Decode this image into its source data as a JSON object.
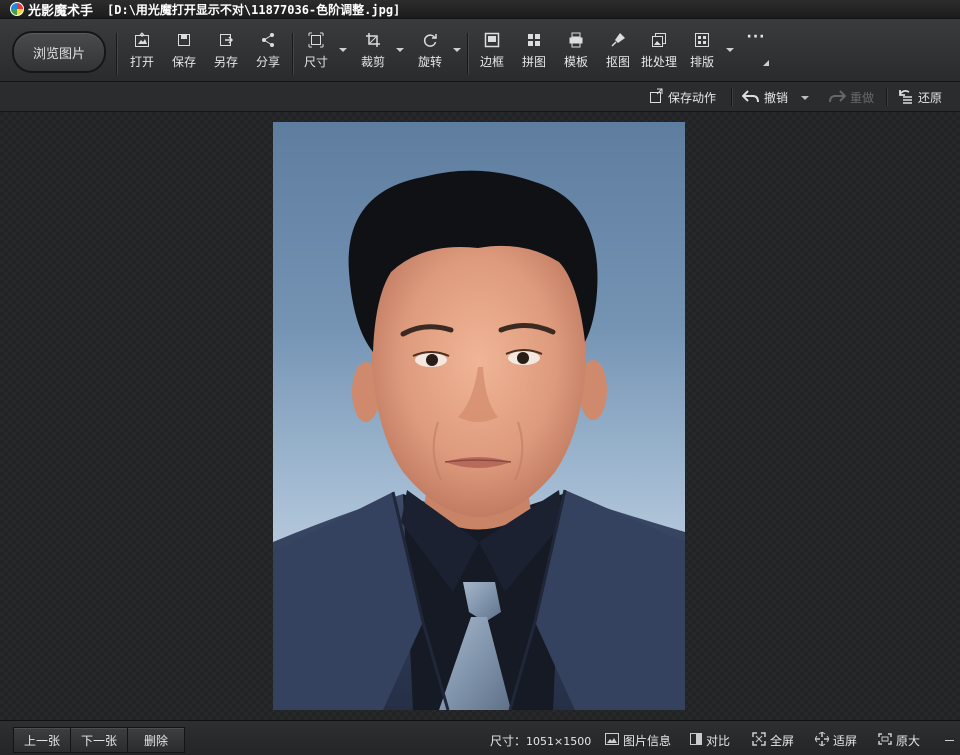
{
  "window": {
    "app_name": "光影魔术手",
    "file_path": "[D:\\用光魔打开显示不对\\11877036-色阶调整.jpg]"
  },
  "toolbar": {
    "browse_label": "浏览图片",
    "items": [
      {
        "label": "打开",
        "icon": "open-icon"
      },
      {
        "label": "保存",
        "icon": "save-icon"
      },
      {
        "label": "另存",
        "icon": "save-as-icon"
      },
      {
        "label": "分享",
        "icon": "share-icon"
      },
      {
        "label": "尺寸",
        "icon": "resize-icon"
      },
      {
        "label": "裁剪",
        "icon": "crop-icon"
      },
      {
        "label": "旋转",
        "icon": "rotate-icon"
      },
      {
        "label": "边框",
        "icon": "border-icon"
      },
      {
        "label": "拼图",
        "icon": "collage-icon"
      },
      {
        "label": "模板",
        "icon": "template-icon"
      },
      {
        "label": "抠图",
        "icon": "cutout-icon"
      },
      {
        "label": "批处理",
        "icon": "batch-icon"
      },
      {
        "label": "排版",
        "icon": "layout-icon"
      }
    ],
    "more_label": "···"
  },
  "actionbar": {
    "save_action": "保存动作",
    "undo": "撤销",
    "redo": "重做",
    "restore": "还原"
  },
  "statusbar": {
    "prev": "上一张",
    "next": "下一张",
    "delete": "删除",
    "size_label": "尺寸：",
    "size_value": "1051×1500",
    "info": "图片信息",
    "compare": "对比",
    "fullscreen": "全屏",
    "fit": "适屏",
    "original": "原大"
  },
  "colors": {
    "background": "#1e1f21",
    "toolbar": "#333436",
    "photo_backdrop": "#7594b4",
    "suit": "#2e3a55"
  }
}
